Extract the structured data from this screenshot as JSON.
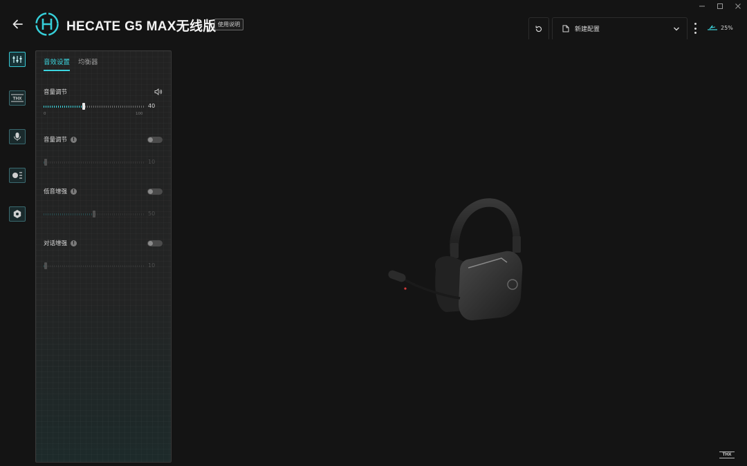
{
  "app": {
    "title": "HECATE G5 MAX无线版",
    "manual_label": "使用说明"
  },
  "header": {
    "config_name": "新建配置",
    "battery": "25%"
  },
  "side_rail": {
    "items": [
      {
        "name": "equalizer-icon"
      },
      {
        "name": "thx-icon"
      },
      {
        "name": "microphone-icon"
      },
      {
        "name": "lighting-icon"
      },
      {
        "name": "settings-icon"
      }
    ]
  },
  "panel": {
    "tabs": [
      {
        "label": "音效设置"
      },
      {
        "label": "均衡器"
      }
    ],
    "settings": [
      {
        "label": "音量调节",
        "value": "40",
        "value_pct": 0.4,
        "min": "0",
        "max": "100",
        "enabled": true
      },
      {
        "label": "音量调节",
        "value": "10",
        "value_pct": 0.02,
        "enabled": false
      },
      {
        "label": "低音增强",
        "value": "50",
        "value_pct": 0.5,
        "enabled": false
      },
      {
        "label": "对话增强",
        "value": "10",
        "value_pct": 0.02,
        "enabled": false
      }
    ]
  },
  "footer": {
    "thx_label": "THX"
  },
  "colors": {
    "accent": "#3cd6e0",
    "background": "#141414",
    "panel": "#232323"
  }
}
